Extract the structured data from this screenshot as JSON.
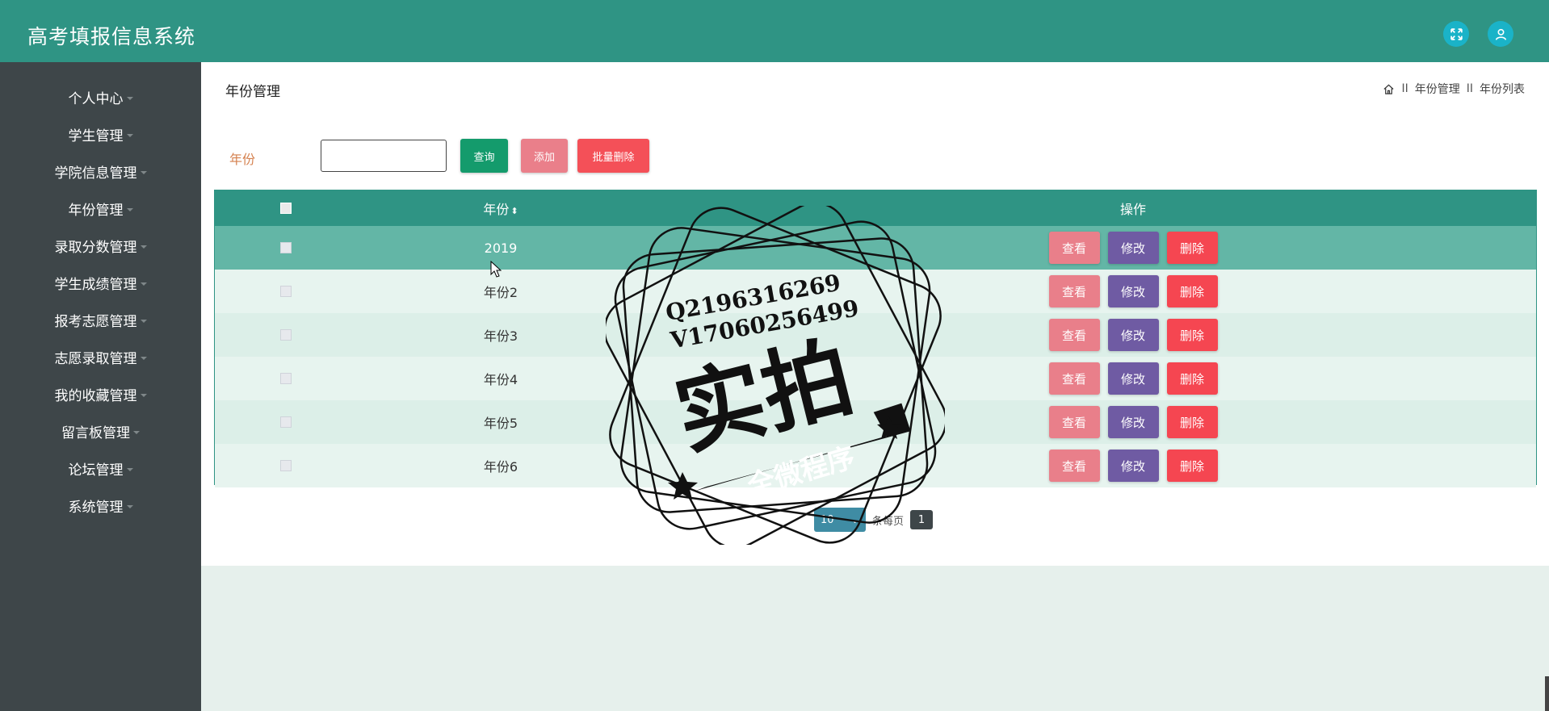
{
  "header": {
    "title": "高考填报信息系统",
    "fullscreen_icon": "expand-icon",
    "user_icon": "user-icon"
  },
  "sidebar": {
    "items": [
      {
        "label": "个人中心"
      },
      {
        "label": "学生管理"
      },
      {
        "label": "学院信息管理"
      },
      {
        "label": "年份管理"
      },
      {
        "label": "录取分数管理"
      },
      {
        "label": "学生成绩管理"
      },
      {
        "label": "报考志愿管理"
      },
      {
        "label": "志愿录取管理"
      },
      {
        "label": "我的收藏管理"
      },
      {
        "label": "留言板管理"
      },
      {
        "label": "论坛管理"
      },
      {
        "label": "系统管理"
      }
    ]
  },
  "main": {
    "page_title": "年份管理",
    "breadcrumb": {
      "sep": "II",
      "items": [
        "年份管理",
        "年份列表"
      ]
    },
    "search": {
      "label": "年份",
      "value": "",
      "placeholder": ""
    },
    "buttons": {
      "query": "查询",
      "add": "添加",
      "batch_delete": "批量删除"
    },
    "table": {
      "columns": [
        "年份",
        "操作"
      ],
      "rows": [
        {
          "year": "2019"
        },
        {
          "year": "年份2"
        },
        {
          "year": "年份3"
        },
        {
          "year": "年份4"
        },
        {
          "year": "年份5"
        },
        {
          "year": "年份6"
        }
      ],
      "actions": {
        "view": "查看",
        "edit": "修改",
        "delete": "删除"
      }
    },
    "pagination": {
      "page_size": "10",
      "per_page_label": "条每页",
      "current_page": "1"
    }
  },
  "watermark": {
    "line1": "Q2196316269",
    "line2": "V17060256499",
    "big": "实拍",
    "band": "全微程序"
  },
  "colors": {
    "header_bg": "#2f9484",
    "sidebar_bg": "#3e4649",
    "accent": "#2f9484"
  }
}
